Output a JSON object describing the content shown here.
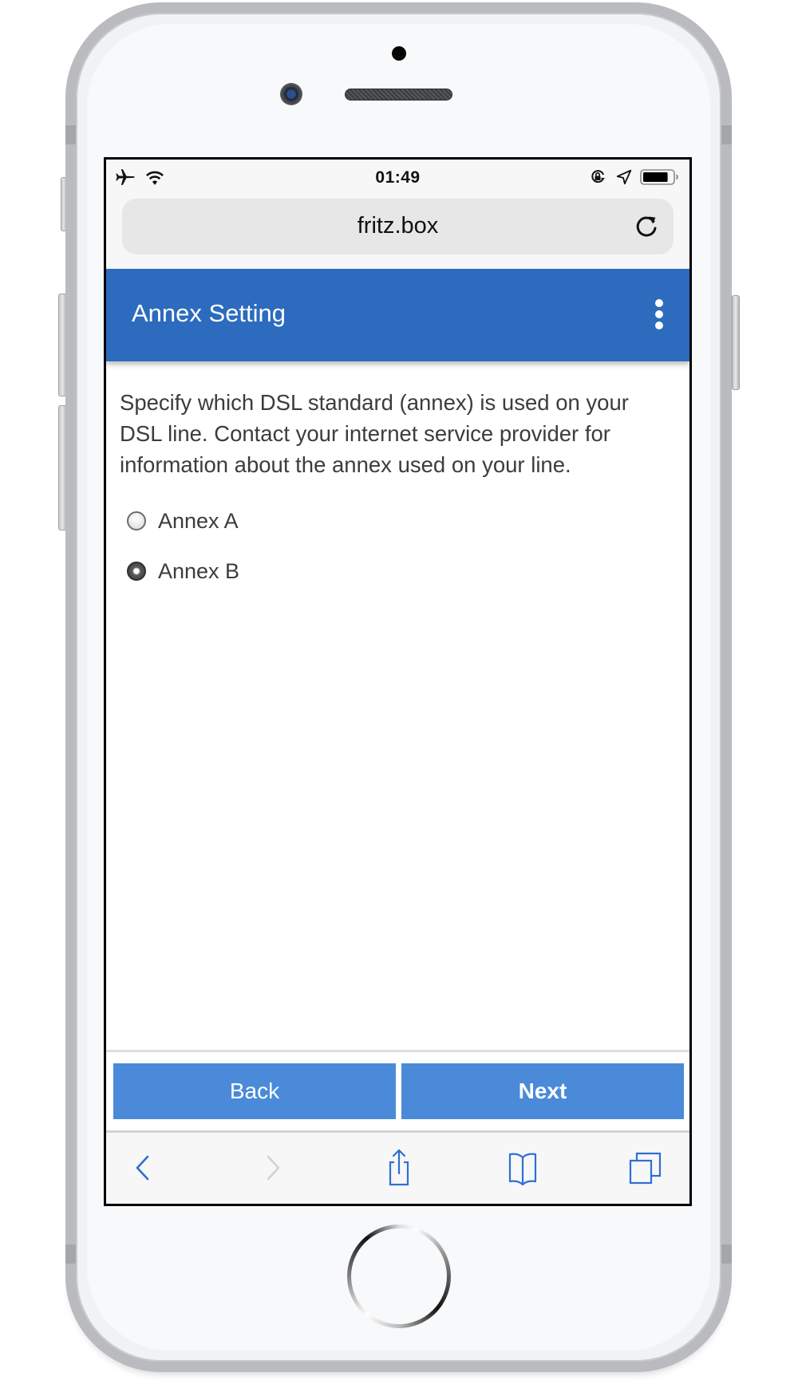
{
  "status_bar": {
    "time": "01:49",
    "left_icons": [
      "airplane-icon",
      "wifi-icon"
    ],
    "right_icons": [
      "rotation-lock-icon",
      "location-icon",
      "battery-icon"
    ],
    "battery_level": 0.85
  },
  "browser": {
    "address": "fritz.box",
    "reload_icon": "reload-icon",
    "toolbar": {
      "buttons": [
        "back-icon",
        "forward-icon",
        "share-icon",
        "bookmarks-icon",
        "tabs-icon"
      ],
      "forward_enabled": false
    }
  },
  "page": {
    "title": "Annex Setting",
    "menu_icon": "more-vertical-icon",
    "description": "Specify which DSL standard (annex) is used on your DSL line. Contact your internet service provider for information about the annex used on your line.",
    "options": [
      {
        "label": "Annex A",
        "checked": false
      },
      {
        "label": "Annex B",
        "checked": true
      }
    ],
    "buttons": {
      "back": "Back",
      "next": "Next"
    }
  },
  "colors": {
    "header_blue": "#2c6bbd",
    "button_blue": "#4a8ad8",
    "ios_blue": "#2f6fd6"
  }
}
